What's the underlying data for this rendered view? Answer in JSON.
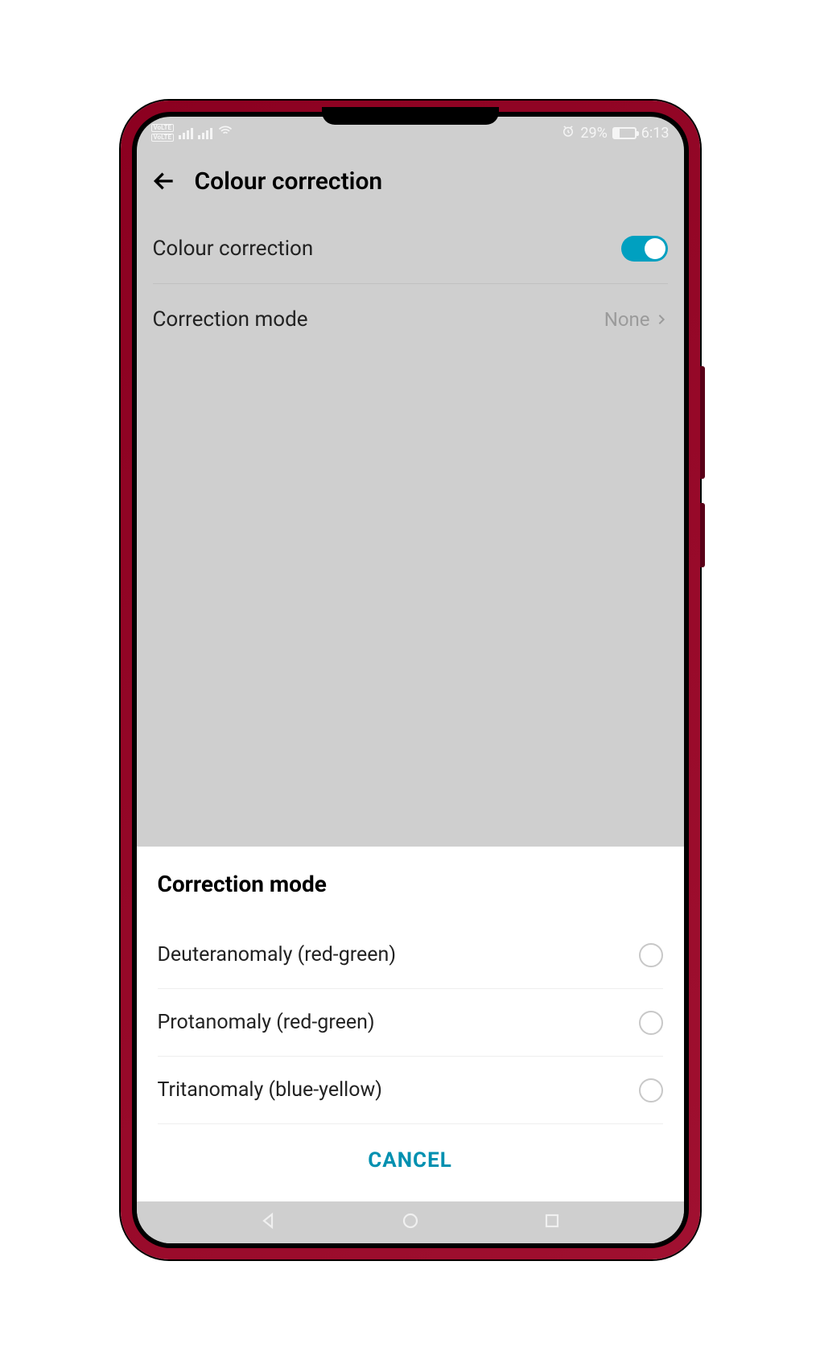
{
  "status": {
    "volte": "VoLTE",
    "battery_pct": "29%",
    "time": "6:13"
  },
  "header": {
    "title": "Colour correction"
  },
  "rows": {
    "toggle_label": "Colour correction",
    "mode_label": "Correction mode",
    "mode_value": "None"
  },
  "sheet": {
    "title": "Correction mode",
    "options": [
      "Deuteranomaly (red-green)",
      "Protanomaly (red-green)",
      "Tritanomaly (blue-yellow)"
    ],
    "cancel": "CANCEL"
  }
}
